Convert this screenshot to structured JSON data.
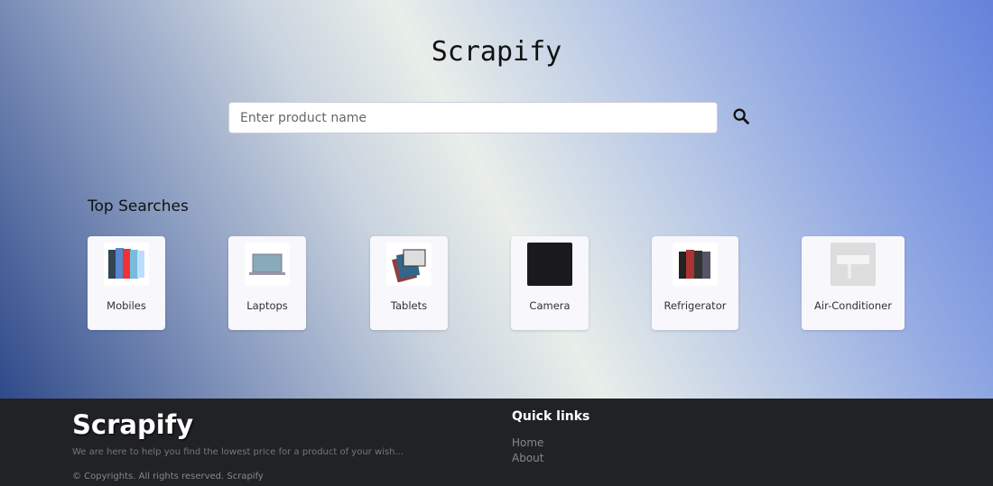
{
  "header": {
    "title": "Scrapify",
    "search_placeholder": "Enter product name"
  },
  "top_searches": {
    "heading": "Top Searches",
    "items": [
      {
        "label": "Mobiles"
      },
      {
        "label": "Laptops"
      },
      {
        "label": "Tablets"
      },
      {
        "label": "Camera"
      },
      {
        "label": "Refrigerator"
      },
      {
        "label": "Air-Conditioner"
      }
    ]
  },
  "footer": {
    "brand": "Scrapify",
    "tagline": "We are here to help you find the lowest price for a product of your wish...",
    "copyright": "© Copyrights. All rights reserved. Scrapify",
    "quick_links_heading": "Quick links",
    "links": [
      "Home",
      "About"
    ]
  }
}
